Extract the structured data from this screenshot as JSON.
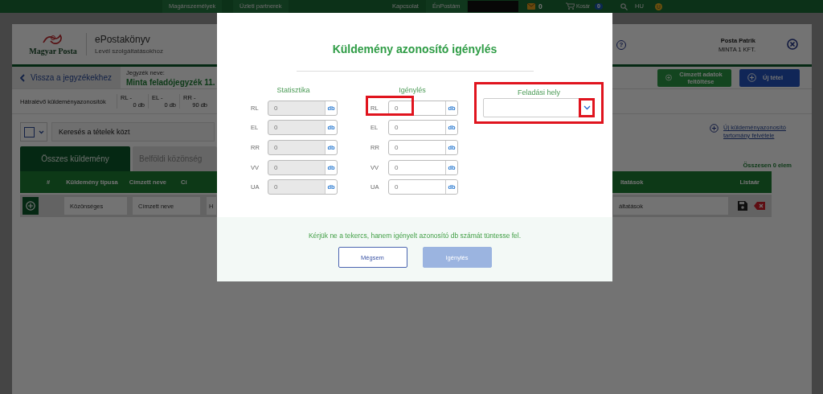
{
  "top_nav": {
    "links": [
      "Magánszemélyek",
      "Üzleti partnerek"
    ],
    "contact": "Kapcsolat",
    "account": "ÉnPostám",
    "mail_count": "0",
    "cart_label": "Kosár",
    "cart_count": "0",
    "language": "HU"
  },
  "header": {
    "logo": "Magyar Posta",
    "app_name": "ePostakönyv",
    "app_subtitle": "Levél szolgáltatásokhoz",
    "help": "?",
    "user_name": "Posta Patrik",
    "company": "MINTA 1 KFT."
  },
  "toolbar": {
    "back": "Vissza a jegyzékekhez",
    "list_label": "Jegyzék neve:",
    "list_name": "Minta feladójegyzék 11.",
    "buttons": [
      {
        "label": "Címzett adatok feltöltése",
        "kind": "upload"
      },
      {
        "label": "Új tétel",
        "kind": "add"
      }
    ]
  },
  "remaining": {
    "label": "Hátralévő küldeményazonosítók",
    "counters": [
      {
        "code": "RL -",
        "count": "0 db"
      },
      {
        "code": "EL -",
        "count": "0 db"
      },
      {
        "code": "RR -",
        "count": "90 db"
      }
    ]
  },
  "search": {
    "placeholder": "Keresés a tételek közt",
    "add_range_link": "Új küldeményazonosító tartomány felvétele"
  },
  "tabs": [
    {
      "label": "Összes küldemény",
      "selected": true
    },
    {
      "label": "Belföldi közönség",
      "selected": false
    }
  ],
  "total": "Összesen 0 elem",
  "table": {
    "columns_left": [
      "#",
      "Küldemény típusa",
      "Címzett neve",
      "Cí"
    ],
    "columns_right": [
      "ltatások",
      "Listaár"
    ],
    "new_row": {
      "type": "Közönséges",
      "recipient_placeholder": "Címzett neve",
      "country": "H",
      "services_placeholder": "áltatások"
    }
  },
  "dialog": {
    "title": "Küldemény azonosító igénylés",
    "columns": [
      {
        "heading": "Statisztika",
        "disabled": true,
        "rows": [
          {
            "label": "RL",
            "value": "0",
            "unit": "db",
            "highlighted": false
          },
          {
            "label": "EL",
            "value": "0",
            "unit": "db",
            "highlighted": false
          },
          {
            "label": "RR",
            "value": "0",
            "unit": "db",
            "highlighted": false
          },
          {
            "label": "VV",
            "value": "0",
            "unit": "db",
            "highlighted": false
          },
          {
            "label": "UA",
            "value": "0",
            "unit": "db",
            "highlighted": false
          }
        ]
      },
      {
        "heading": "Igénylés",
        "disabled": false,
        "rows": [
          {
            "label": "RL",
            "value": "0",
            "unit": "db",
            "highlighted": true
          },
          {
            "label": "EL",
            "value": "0",
            "unit": "db",
            "highlighted": false
          },
          {
            "label": "RR",
            "value": "0",
            "unit": "db",
            "highlighted": false
          },
          {
            "label": "VV",
            "value": "0",
            "unit": "db",
            "highlighted": false
          },
          {
            "label": "UA",
            "value": "0",
            "unit": "db",
            "highlighted": false
          }
        ]
      }
    ],
    "location": {
      "label": "Feladási hely",
      "highlighted": true,
      "caret_highlighted": true
    },
    "message": "Kérjük ne a tekercs, hanem igényelt azonosító db számát tüntesse fel.",
    "buttons": [
      {
        "label": "Mégsem",
        "disabled": false
      },
      {
        "label": "Igénylés",
        "disabled": true
      }
    ]
  }
}
